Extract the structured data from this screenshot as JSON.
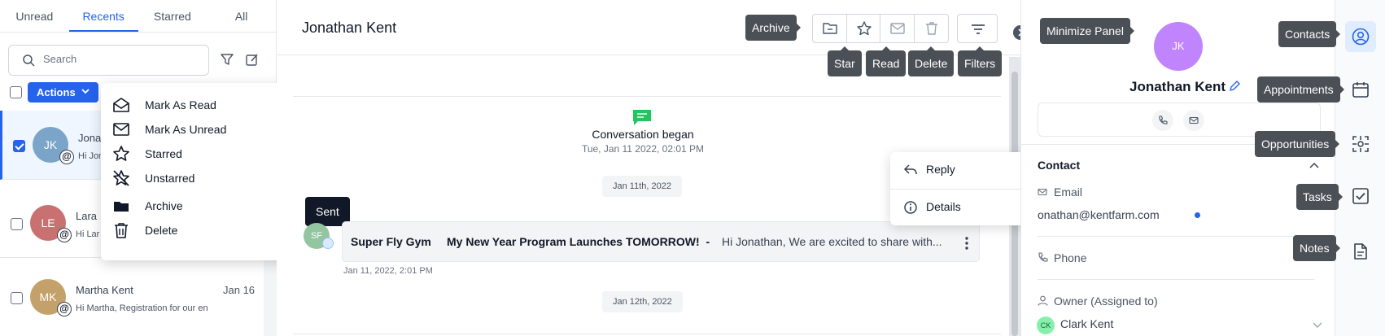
{
  "tabs": [
    "Unread",
    "Recents",
    "Starred",
    "All"
  ],
  "active_tab": "Recents",
  "search": {
    "placeholder": "Search"
  },
  "actions_label": "Actions",
  "conversations": [
    {
      "initials": "JK",
      "name": "Jona",
      "preview": "Hi Jon",
      "date": "",
      "color": "#7aa5c8",
      "checked": true
    },
    {
      "initials": "LE",
      "name": "Lara",
      "preview": "Hi Lar",
      "date": "",
      "color": "#c97070",
      "checked": false
    },
    {
      "initials": "MK",
      "name": "Martha Kent",
      "preview": "Hi Martha, Registration for our en",
      "date": "Jan 16",
      "color": "#c4a06b",
      "checked": false
    }
  ],
  "actions_menu": [
    "Mark As Read",
    "Mark As Unread",
    "Starred",
    "Unstarred",
    "Archive",
    "Delete"
  ],
  "conversation": {
    "title": "Jonathan Kent",
    "tooltips": {
      "archive": "Archive",
      "star": "Star",
      "read": "Read",
      "delete": "Delete",
      "filters": "Filters",
      "minimize": "Minimize Panel",
      "sent": "Sent"
    },
    "began_title": "Conversation began",
    "began_date": "Tue, Jan 11 2022, 02:01 PM",
    "date_chip_1": "Jan 11th, 2022",
    "date_chip_2": "Jan 12th, 2022",
    "message": {
      "avatar": "SF",
      "from": "Super Fly Gym",
      "subject": "My New Year Program Launches TOMORROW!",
      "separator": "-",
      "preview": "Hi Jonathan, We are excited to share with...",
      "time": "Jan 11, 2022, 2:01 PM"
    },
    "context_menu": [
      "Reply",
      "Details"
    ]
  },
  "contact": {
    "initials": "JK",
    "name": "Jonathan Kent",
    "section": "Contact",
    "email_label": "Email",
    "email": "onathan@kentfarm.com",
    "phone_label": "Phone",
    "owner_label": "Owner (Assigned to)",
    "owner_initials": "CK",
    "owner": "Clark Kent"
  },
  "rail": [
    "Contacts",
    "Appointments",
    "Opportunities",
    "Tasks",
    "Notes"
  ],
  "colors": {
    "accent": "#2563eb",
    "tooltip": "#4b4f56",
    "contact_avatar": "#c084fc"
  }
}
